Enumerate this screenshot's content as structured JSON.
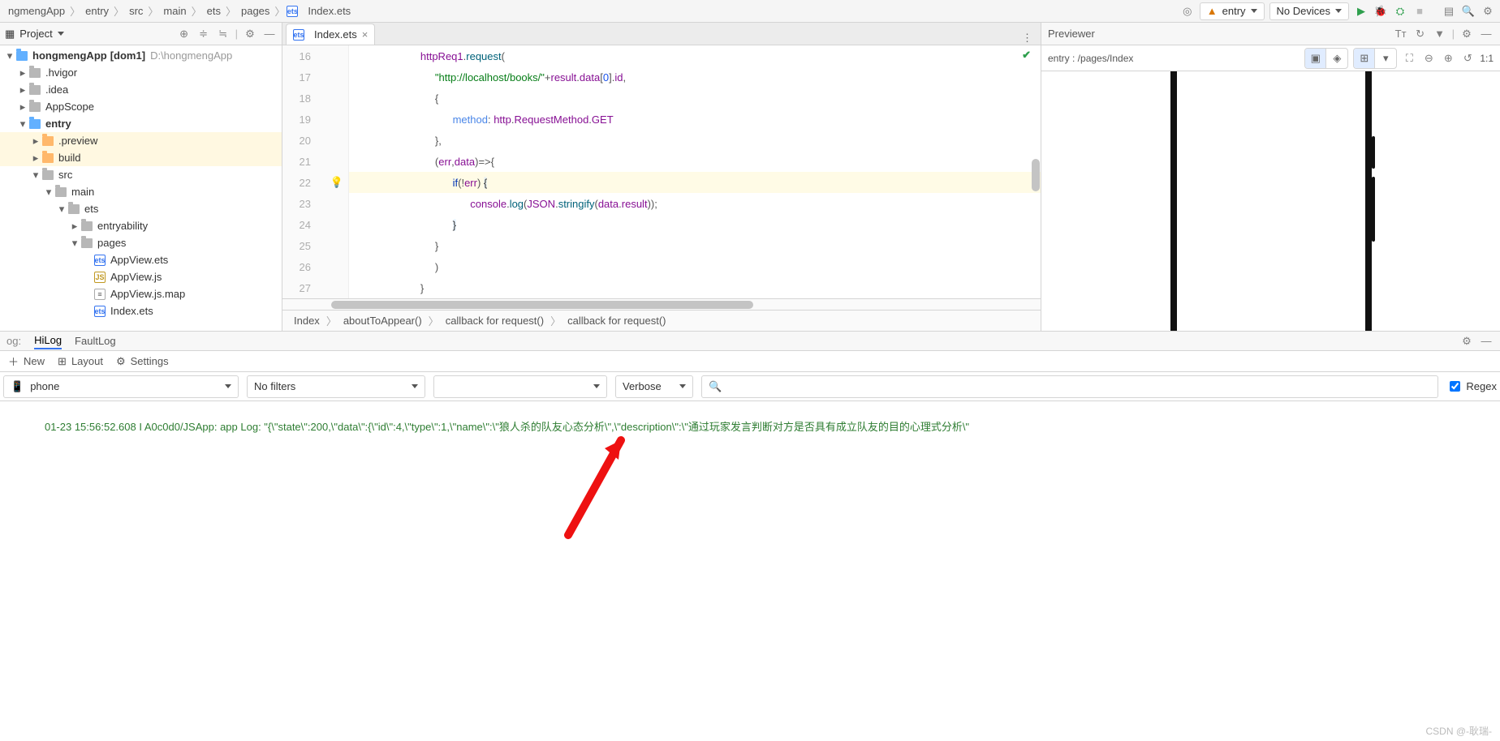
{
  "breadcrumbs": [
    "ngmengApp",
    "entry",
    "src",
    "main",
    "ets",
    "pages",
    "Index.ets"
  ],
  "top_toolbar": {
    "run_config": "entry",
    "device_select": "No Devices"
  },
  "sidebar": {
    "title_label": "Project",
    "root": {
      "name": "hongmengApp",
      "mod": "[dom1]",
      "path": "D:\\hongmengApp"
    },
    "nodes": [
      {
        "name": ".hvigor",
        "depth": 1,
        "exp": false,
        "folder": "gray"
      },
      {
        "name": ".idea",
        "depth": 1,
        "exp": false,
        "folder": "gray"
      },
      {
        "name": "AppScope",
        "depth": 1,
        "exp": false,
        "folder": "gray"
      },
      {
        "name": "entry",
        "depth": 1,
        "exp": true,
        "folder": "blue",
        "bold": true
      },
      {
        "name": ".preview",
        "depth": 2,
        "exp": false,
        "folder": "orange",
        "hl": true
      },
      {
        "name": "build",
        "depth": 2,
        "exp": false,
        "folder": "orange",
        "hl": true
      },
      {
        "name": "src",
        "depth": 2,
        "exp": true,
        "folder": "gray"
      },
      {
        "name": "main",
        "depth": 3,
        "exp": true,
        "folder": "gray"
      },
      {
        "name": "ets",
        "depth": 4,
        "exp": true,
        "folder": "gray"
      },
      {
        "name": "entryability",
        "depth": 5,
        "exp": false,
        "folder": "gray"
      },
      {
        "name": "pages",
        "depth": 5,
        "exp": true,
        "folder": "gray"
      },
      {
        "name": "AppView.ets",
        "depth": 6,
        "file": "ets"
      },
      {
        "name": "AppView.js",
        "depth": 6,
        "file": "js"
      },
      {
        "name": "AppView.js.map",
        "depth": 6,
        "file": "map"
      },
      {
        "name": "Index.ets",
        "depth": 6,
        "file": "ets",
        "truncated": true
      }
    ]
  },
  "editor": {
    "tab_label": "Index.ets",
    "line_start": 16,
    "lines": [
      {
        "t": [
          " ",
          "httpReq1",
          ".",
          "request",
          "("
        ],
        "cls": [
          "",
          "id",
          "punc",
          "fn",
          "punc"
        ]
      },
      {
        "t": [
          "  ",
          "\"http://localhost/books/\"",
          "+",
          "result",
          ".",
          "data",
          "[",
          "0",
          "]",
          ".",
          "id",
          ","
        ],
        "cls": [
          "",
          "str",
          "punc",
          "id",
          "punc",
          "id",
          "punc",
          "num",
          "punc",
          "punc",
          "id",
          "punc"
        ]
      },
      {
        "t": [
          "  ",
          "{"
        ],
        "cls": [
          "",
          "punc"
        ]
      },
      {
        "t": [
          "    ",
          "method",
          ": ",
          "http",
          ".",
          "RequestMethod",
          ".",
          "GET"
        ],
        "cls": [
          "",
          "prop",
          "punc",
          "id",
          "punc",
          "id",
          "punc",
          "id"
        ]
      },
      {
        "t": [
          "  ",
          "},"
        ],
        "cls": [
          "",
          "punc"
        ]
      },
      {
        "t": [
          "  ",
          "(",
          "err",
          ",",
          "data",
          ")",
          "=>",
          "{"
        ],
        "cls": [
          "",
          "punc",
          "id",
          "punc",
          "id",
          "punc",
          "punc",
          "punc"
        ]
      },
      {
        "t": [
          "    ",
          "if",
          "(",
          "!",
          "err",
          ") ",
          "{"
        ],
        "cls": [
          "",
          "kw",
          "punc",
          "punc",
          "id",
          "punc",
          "hl"
        ],
        "cur": true
      },
      {
        "t": [
          "      ",
          "console",
          ".",
          "log",
          "(",
          "JSON",
          ".",
          "stringify",
          "(",
          "data",
          ".",
          "result",
          "))",
          ";"
        ],
        "cls": [
          "",
          "id",
          "punc",
          "fn",
          "punc",
          "id",
          "punc",
          "fn",
          "punc",
          "id",
          "punc",
          "id",
          "punc",
          "punc"
        ]
      },
      {
        "t": [
          "    ",
          "}"
        ],
        "cls": [
          "",
          "hl"
        ]
      },
      {
        "t": [
          "  ",
          "}"
        ],
        "cls": [
          "",
          "punc"
        ]
      },
      {
        "t": [
          "  ",
          ")"
        ],
        "cls": [
          "",
          "punc"
        ]
      },
      {
        "t": [
          " ",
          "}"
        ],
        "cls": [
          "",
          "punc"
        ]
      }
    ],
    "breadcrumb": [
      "Index",
      "aboutToAppear()",
      "callback for request()",
      "callback for request()"
    ]
  },
  "previewer": {
    "title": "Previewer",
    "path": "entry : /pages/Index",
    "ratio": "1:1"
  },
  "log": {
    "tabs_label_prefix": "og:",
    "tabs": [
      "HiLog",
      "FaultLog"
    ],
    "active_tab": "HiLog",
    "toolbar": {
      "new": "New",
      "layout": "Layout",
      "settings": "Settings"
    },
    "filter_device": "phone",
    "filter_level": "No filters",
    "filter_verbose": "Verbose",
    "search_placeholder": "",
    "regex_label": "Regex",
    "line": "01-23 15:56:52.608 I A0c0d0/JSApp: app Log: \"{\\\"state\\\":200,\\\"data\\\":{\\\"id\\\":4,\\\"type\\\":1,\\\"name\\\":\\\"狼人杀的队友心态分析\\\",\\\"description\\\":\\\"通过玩家发言判断对方是否具有成立队友的目的心理式分析\\\""
  },
  "watermark": "CSDN @-耿瑞-"
}
